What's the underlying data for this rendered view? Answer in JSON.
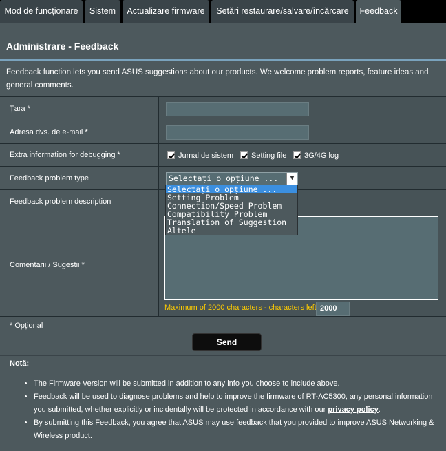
{
  "tabs": [
    {
      "label": "Mod de funcționare",
      "active": false
    },
    {
      "label": "Sistem",
      "active": false
    },
    {
      "label": "Actualizare firmware",
      "active": false
    },
    {
      "label": "Setări restaurare/salvare/încărcare",
      "active": false
    },
    {
      "label": "Feedback",
      "active": true
    }
  ],
  "page": {
    "title": "Administrare - Feedback",
    "description": "Feedback function lets you send ASUS suggestions about our products. We welcome problem reports, feature ideas and general comments."
  },
  "form": {
    "country_label": "Țara *",
    "country_value": "",
    "email_label": "Adresa dvs. de e-mail *",
    "email_value": "",
    "debug_label": "Extra information for debugging *",
    "debug_options": [
      {
        "label": "Jurnal de sistem",
        "checked": true
      },
      {
        "label": "Setting file",
        "checked": true
      },
      {
        "label": "3G/4G log",
        "checked": true
      }
    ],
    "problem_type_label": "Feedback problem type",
    "problem_type_selected": "Selectați o opțiune ...",
    "problem_type_options": [
      "Selectați o opțiune ...",
      "Setting Problem",
      "Connection/Speed Problem",
      "Compatibility Problem",
      "Translation of Suggestion",
      "Altele"
    ],
    "problem_desc_label": "Feedback problem description",
    "comments_label": "Comentarii / Sugestii *",
    "comments_value": "",
    "max_note": "Maximum of 2000 characters - characters left :",
    "chars_left": "2000",
    "optional_note": "* Opțional",
    "send_label": "Send"
  },
  "notes": {
    "title": "Notă:",
    "items": [
      "The Firmware Version will be submitted in addition to any info you choose to include above.",
      "Feedback will be used to diagnose problems and help to improve the firmware of RT-AC5300, any personal information you submitted, whether explicitly or incidentally will be protected in accordance with our",
      "By submitting this Feedback, you agree that ASUS may use feedback that you provided to improve ASUS Networking & Wireless product."
    ],
    "privacy_link": "privacy policy",
    "privacy_suffix": "."
  },
  "colors": {
    "panel_bg": "#4d595d",
    "accent_line": "#7aa3bd",
    "warning_text": "#ffcc00",
    "selected_option": "#3b8fe0"
  },
  "icons": {
    "select_arrow": "chevron-down-icon",
    "checkbox": "check-icon",
    "resize": "resize-grip-icon"
  }
}
